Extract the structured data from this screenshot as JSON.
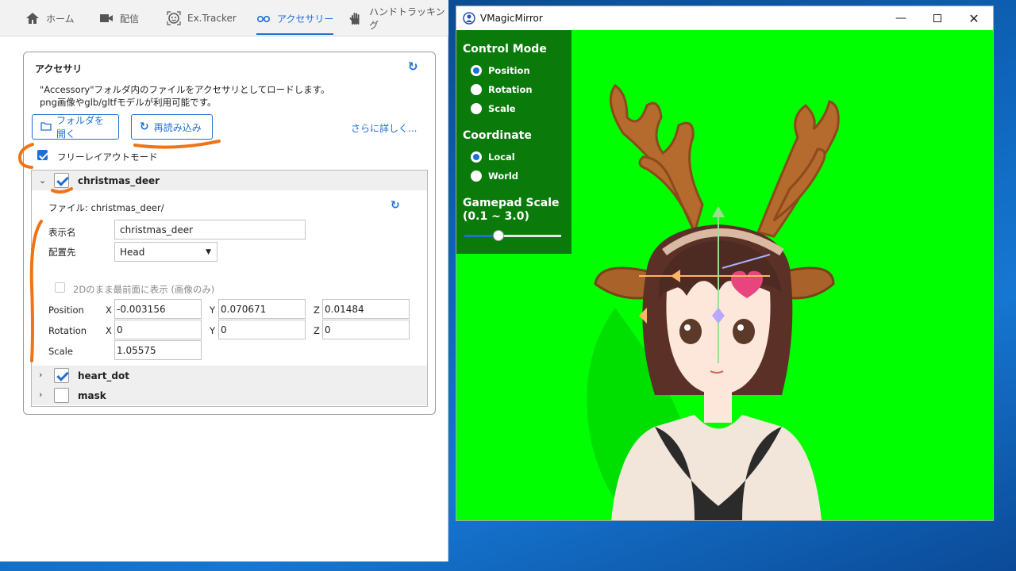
{
  "tabs": [
    {
      "label": "ホーム",
      "icon": "home-icon"
    },
    {
      "label": "配信",
      "icon": "camera-icon"
    },
    {
      "label": "Ex.Tracker",
      "icon": "face-tracker-icon"
    },
    {
      "label": "アクセサリー",
      "icon": "glasses-icon",
      "active": true
    },
    {
      "label": "ハンドトラッキング",
      "icon": "hand-icon"
    }
  ],
  "accessory": {
    "title": "アクセサリ",
    "desc1": "\"Accessory\"フォルダ内のファイルをアクセサリとしてロードします。",
    "desc2": "png画像やglb/gltfモデルが利用可能です。",
    "open_folder": "フォルダを開く",
    "reload": "再読み込み",
    "more": "さらに詳しく...",
    "free_layout": "フリーレイアウトモード",
    "items": [
      {
        "name": "christmas_deer",
        "checked": true,
        "expanded": true
      },
      {
        "name": "heart_dot",
        "checked": true,
        "expanded": false
      },
      {
        "name": "mask",
        "checked": false,
        "expanded": false
      }
    ],
    "detail": {
      "file": "ファイル: christmas_deer/",
      "display_name_label": "表示名",
      "display_name": "christmas_deer",
      "attach_label": "配置先",
      "attach_value": "Head",
      "show_2d": "2Dのまま最前面に表示 (画像のみ)",
      "position_label": "Position",
      "rotation_label": "Rotation",
      "scale_label": "Scale",
      "pos": {
        "x": "-0.003156",
        "y": "0.070671",
        "z": "0.01484"
      },
      "rot": {
        "x": "0",
        "y": "0",
        "z": "0"
      },
      "scale": "1.05575",
      "x": "X",
      "y": "Y",
      "z": "Z"
    }
  },
  "vmm": {
    "title": "VMagicMirror",
    "control_mode": "Control Mode",
    "modes": [
      "Position",
      "Rotation",
      "Scale"
    ],
    "selected_mode": "Position",
    "coordinate": "Coordinate",
    "coords": [
      "Local",
      "World"
    ],
    "selected_coord": "Local",
    "gamepad_scale_1": "Gamepad Scale",
    "gamepad_scale_2": "(0.1 ~ 3.0)",
    "gamepad_scale_value": 0.35
  }
}
